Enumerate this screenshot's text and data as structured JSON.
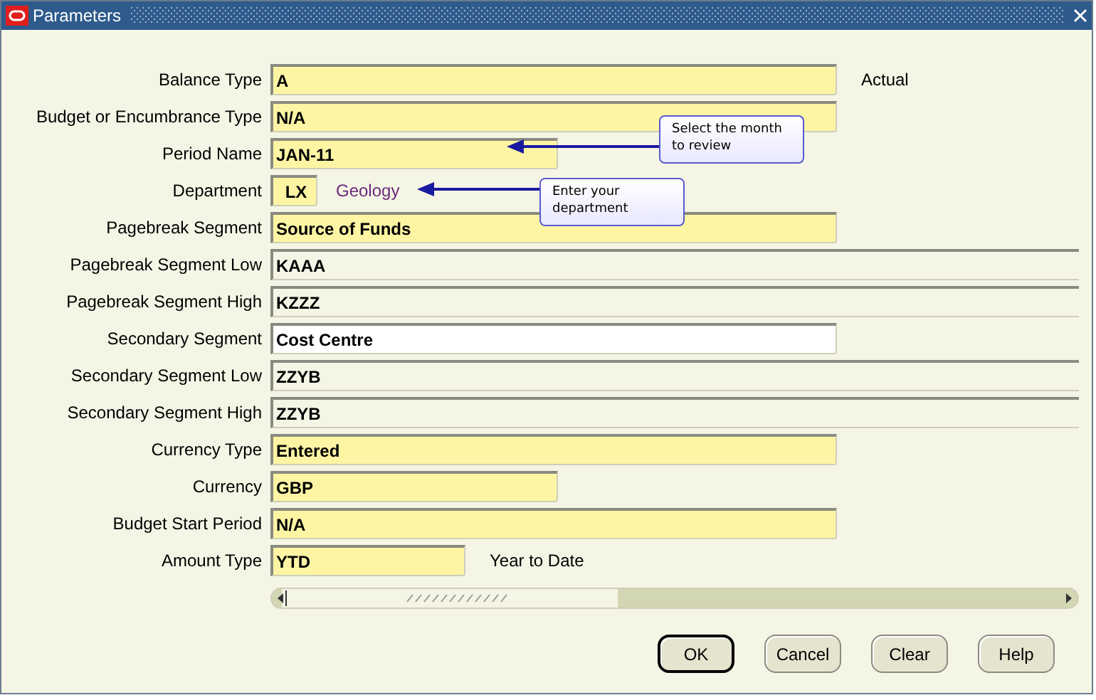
{
  "window": {
    "title": "Parameters"
  },
  "fields": [
    {
      "label": "Balance Type",
      "value": "A",
      "kind": "required",
      "description": "Actual"
    },
    {
      "label": "Budget or Encumbrance Type",
      "value": "N/A",
      "kind": "required"
    },
    {
      "label": "Period Name",
      "value": "JAN-11",
      "kind": "required"
    },
    {
      "label": "Department",
      "value": "LX",
      "kind": "required",
      "description": "Geology"
    },
    {
      "label": "Pagebreak Segment",
      "value": "Source of Funds",
      "kind": "required"
    },
    {
      "label": "Pagebreak Segment Low",
      "value": "KAAA",
      "kind": "readonly"
    },
    {
      "label": "Pagebreak Segment High",
      "value": "KZZZ",
      "kind": "readonly"
    },
    {
      "label": "Secondary Segment",
      "value": "Cost Centre",
      "kind": "optional"
    },
    {
      "label": "Secondary Segment Low",
      "value": "ZZYB",
      "kind": "readonly"
    },
    {
      "label": "Secondary Segment High",
      "value": "ZZYB",
      "kind": "readonly"
    },
    {
      "label": "Currency Type",
      "value": "Entered",
      "kind": "required"
    },
    {
      "label": "Currency",
      "value": "GBP",
      "kind": "required"
    },
    {
      "label": "Budget Start Period",
      "value": "N/A",
      "kind": "required"
    },
    {
      "label": "Amount Type",
      "value": "YTD",
      "kind": "required",
      "description": "Year to Date"
    }
  ],
  "callouts": [
    {
      "text": "Select the month\nto review"
    },
    {
      "text": "Enter your\ndepartment"
    }
  ],
  "buttons": [
    {
      "label": "OK",
      "default": true
    },
    {
      "label": "Cancel",
      "default": false
    },
    {
      "label": "Clear",
      "default": false
    },
    {
      "label": "Help",
      "default": false
    }
  ]
}
